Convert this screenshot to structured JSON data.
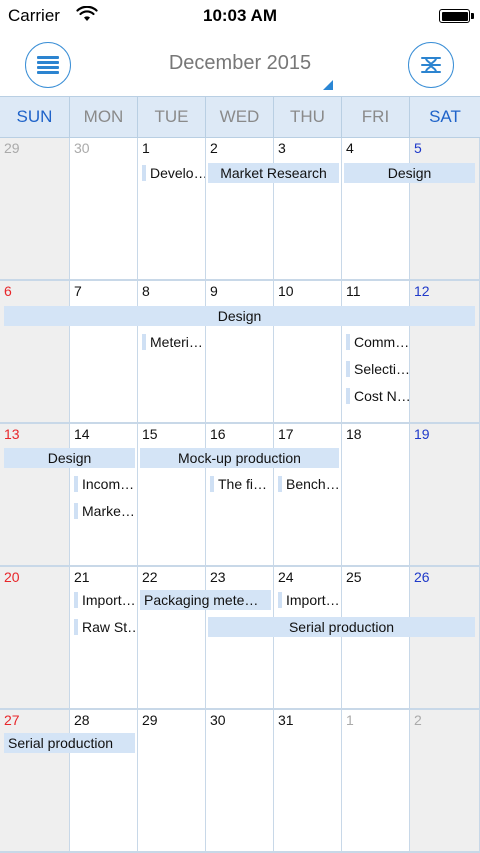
{
  "status_bar": {
    "carrier": "Carrier",
    "time": "10:03 AM"
  },
  "header": {
    "title": "December 2015"
  },
  "weekdays": [
    "SUN",
    "MON",
    "TUE",
    "WED",
    "THU",
    "FRI",
    "SAT"
  ],
  "weeks": [
    [
      "29",
      "30",
      "1",
      "2",
      "3",
      "4",
      "5"
    ],
    [
      "6",
      "7",
      "8",
      "9",
      "10",
      "11",
      "12"
    ],
    [
      "13",
      "14",
      "15",
      "16",
      "17",
      "18",
      "19"
    ],
    [
      "20",
      "21",
      "22",
      "23",
      "24",
      "25",
      "26"
    ],
    [
      "27",
      "28",
      "29",
      "30",
      "31",
      "1",
      "2"
    ]
  ],
  "events": {
    "w1_develo": "Develo…",
    "w1_market_research": "Market Research",
    "w1_design": "Design",
    "w2_design": "Design",
    "w2_meteri": "Meteri…",
    "w2_comm": "Comm…",
    "w2_selecti": "Selecti…",
    "w2_cost": "Cost N…",
    "w3_design": "Design",
    "w3_mockup": "Mock-up production",
    "w3_incom": "Incom…",
    "w3_marke": "Marke…",
    "w3_thefi": "The fi…",
    "w3_bench": "Bench…",
    "w4_import1": "Import…",
    "w4_rawst": "Raw St…",
    "w4_packaging": "Packaging mete…",
    "w4_import2": "Import…",
    "w4_serial": "Serial production",
    "w5_serial": "Serial production"
  },
  "colors": {
    "accent": "#2a86d4",
    "event_fill": "#d4e4f6",
    "sunday": "#e8262a",
    "saturday": "#1f39c9"
  }
}
